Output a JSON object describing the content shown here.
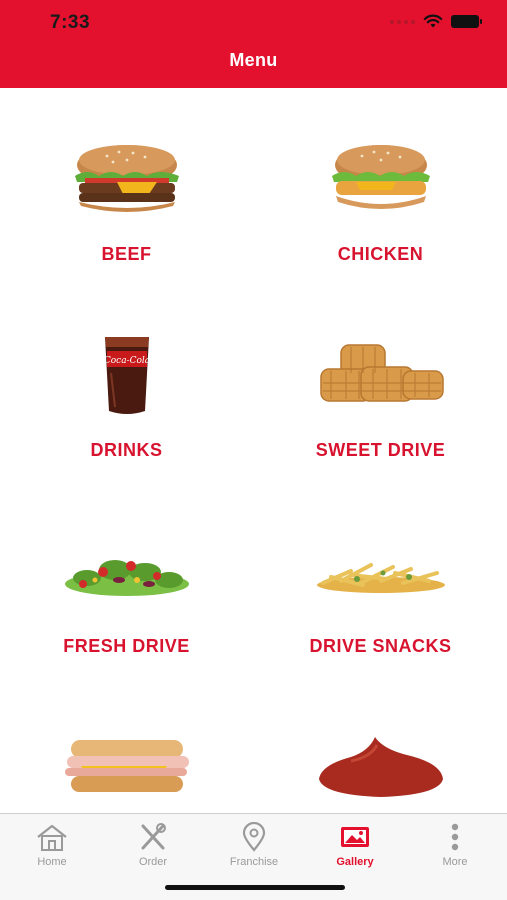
{
  "status_bar": {
    "time": "7:33"
  },
  "header": {
    "title": "Menu"
  },
  "menu": {
    "items": [
      {
        "label": "BEEF",
        "icon": "beef-burger-image"
      },
      {
        "label": "CHICKEN",
        "icon": "chicken-burger-image"
      },
      {
        "label": "DRINKS",
        "icon": "cola-glass-image"
      },
      {
        "label": "SWEET DRIVE",
        "icon": "waffles-image"
      },
      {
        "label": "FRESH DRIVE",
        "icon": "salad-image"
      },
      {
        "label": "DRIVE SNACKS",
        "icon": "fries-image"
      },
      {
        "label": "",
        "icon": "sandwich-image"
      },
      {
        "label": "",
        "icon": "sauce-image"
      }
    ]
  },
  "tabbar": {
    "tabs": [
      {
        "label": "Home",
        "icon": "home-icon"
      },
      {
        "label": "Order",
        "icon": "fork-knife-icon"
      },
      {
        "label": "Franchise",
        "icon": "location-pin-icon"
      },
      {
        "label": "Gallery",
        "icon": "gallery-icon",
        "active": true
      },
      {
        "label": "More",
        "icon": "more-dots-icon"
      }
    ]
  },
  "colors": {
    "brand_red": "#e3102e",
    "label_red": "#d8132f",
    "inactive_gray": "#9a9a9a"
  }
}
